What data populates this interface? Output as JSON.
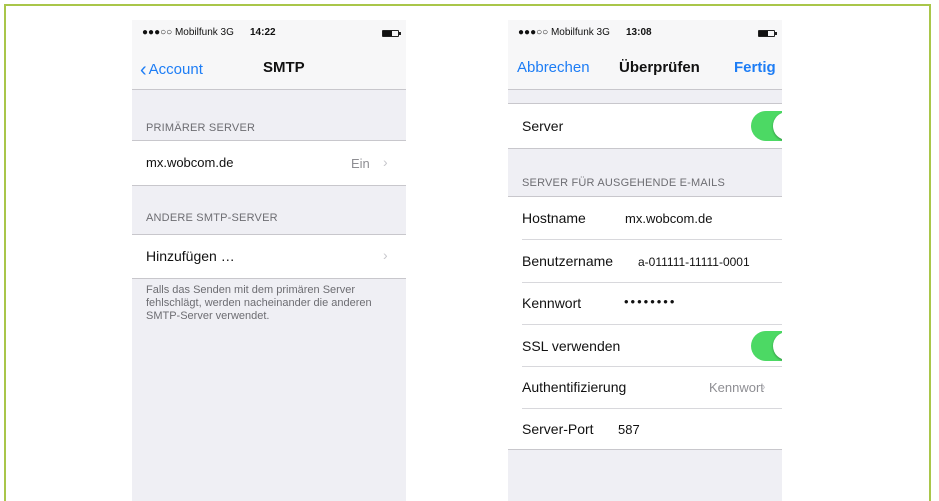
{
  "left": {
    "status": {
      "signal": "●●●○○ Mobilfunk  3G",
      "time": "14:22"
    },
    "nav": {
      "back": "Account",
      "title": "SMTP"
    },
    "primary_header": "PRIMÄRER SERVER",
    "primary_server": {
      "name": "mx.wobcom.de",
      "state": "Ein"
    },
    "other_header": "ANDERE SMTP-SERVER",
    "add_label": "Hinzufügen …",
    "footer": "Falls das Senden mit dem primären Server fehlschlägt, werden nacheinander die anderen SMTP-Server verwendet."
  },
  "right": {
    "status": {
      "signal": "●●●○○ Mobilfunk  3G",
      "time": "13:08"
    },
    "nav": {
      "cancel": "Abbrechen",
      "title": "Überprüfen",
      "done": "Fertig"
    },
    "server_label": "Server",
    "server_on": true,
    "section_header": "SERVER FÜR AUSGEHENDE E-MAILS",
    "fields": {
      "hostname_label": "Hostname",
      "hostname_value": "mx.wobcom.de",
      "username_label": "Benutzername",
      "username_value": "a-011111-11111-0001",
      "password_label": "Kennwort",
      "password_value": "••••••••",
      "ssl_label": "SSL verwenden",
      "ssl_on": true,
      "auth_label": "Authentifizierung",
      "auth_value": "Kennwort",
      "port_label": "Server-Port",
      "port_value": "587"
    }
  },
  "colors": {
    "accent": "#1d7df5",
    "toggle_on": "#4cd964",
    "frame": "#a9c64a"
  }
}
